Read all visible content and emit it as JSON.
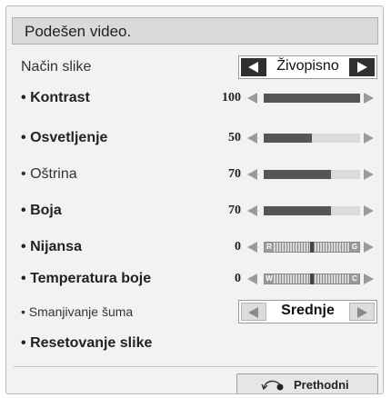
{
  "title": "Podešen video.",
  "picture_mode": {
    "label": "Način slike",
    "value": "Živopisno"
  },
  "sliders": [
    {
      "name": "Kontrast",
      "value": "100",
      "level": 1.0
    },
    {
      "name": "Osvetljenje",
      "value": "50",
      "level": 0.5
    },
    {
      "name": "Oštrina",
      "value": "70",
      "level": 0.7
    },
    {
      "name": "Boja",
      "value": "70",
      "level": 0.7
    }
  ],
  "tint": {
    "name": "Nijansa",
    "value": "0",
    "left": "R",
    "right": "G"
  },
  "color_temp": {
    "name": "Temperatura boje",
    "value": "0",
    "left": "W",
    "right": "C"
  },
  "noise": {
    "label": "Smanjivanje šuma",
    "value": "Srednje"
  },
  "reset": {
    "label": "Resetovanje slike"
  },
  "back_button": {
    "label": "Prethodni",
    "icon": "return-icon"
  },
  "bullet": "•",
  "colors": {
    "panel": "#f2f2f2",
    "selector_button": "#2f2f2f",
    "bar_fill": "#555555",
    "bar_track": "#dadada"
  }
}
